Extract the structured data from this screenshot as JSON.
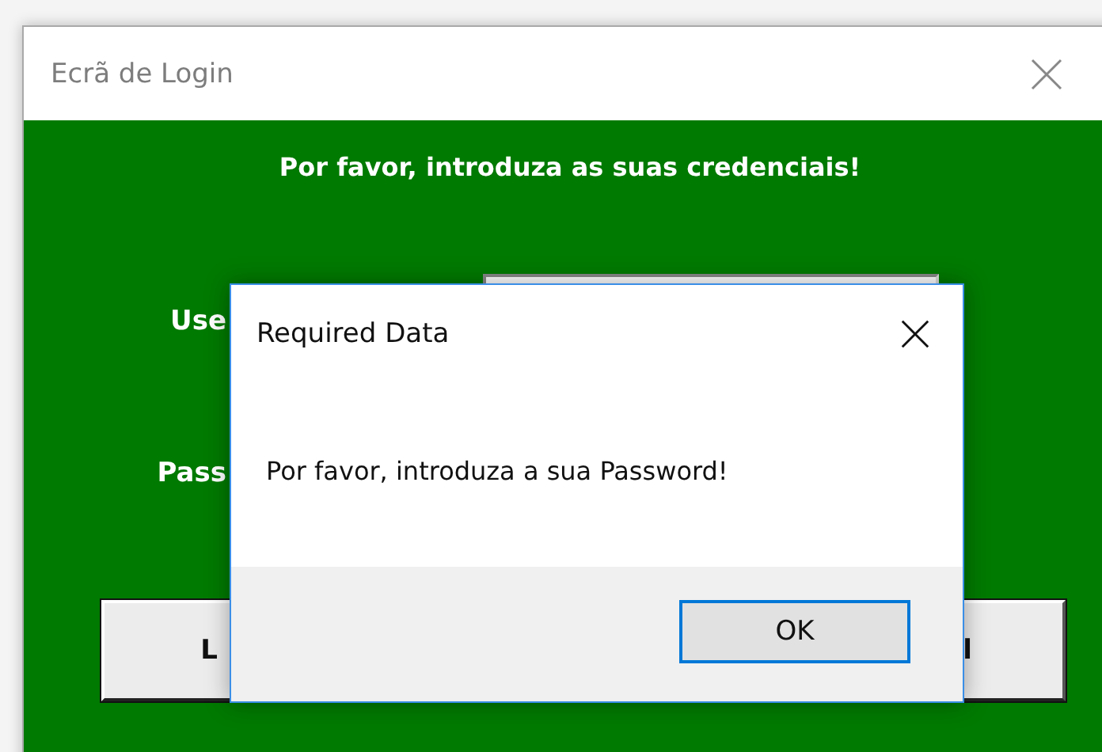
{
  "window": {
    "title": "Ecrã de Login"
  },
  "heading": "Por favor, introduza as suas credenciais!",
  "fields": [
    {
      "label": "Use",
      "input": true
    },
    {
      "label": "Pass",
      "input": false
    }
  ],
  "buttons": [
    {
      "label": "L"
    },
    {
      "label": "l"
    }
  ],
  "dialog": {
    "title": "Required Data",
    "message": "Por favor, introduza a sua Password!",
    "buttons": [
      {
        "label": "OK",
        "default": true
      }
    ]
  }
}
